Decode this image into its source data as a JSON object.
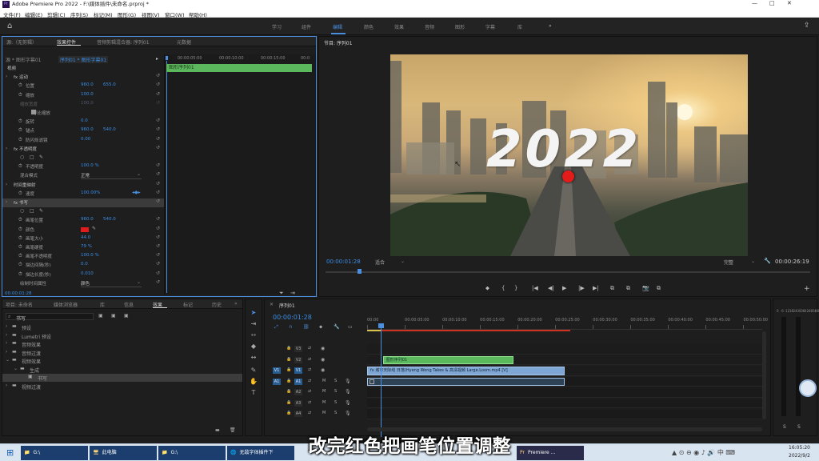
{
  "window": {
    "title": "Adobe Premiere Pro 2022 - F:\\媒体插件\\未命名.prproj *",
    "controls": [
      "—",
      "□",
      "✕"
    ]
  },
  "menu": [
    "文件(F)",
    "编辑(E)",
    "剪辑(C)",
    "序列(S)",
    "标记(M)",
    "图形(G)",
    "视图(V)",
    "窗口(W)",
    "帮助(H)"
  ],
  "workspaces": [
    "学习",
    "组件",
    "编辑",
    "颜色",
    "效果",
    "音频",
    "图形",
    "字幕",
    "库",
    "»"
  ],
  "active_workspace": "编辑",
  "effect_controls": {
    "tabs": [
      "源:（无剪辑）",
      "效果控件",
      "音频剪辑混合器: 序列01",
      "元数据"
    ],
    "source_label": "源 * 图形字幕01",
    "sequence_label": "序列01 * 图形字幕01",
    "ruler": [
      "00:00:05:00",
      "00:00:10:00",
      "00:00:15:00",
      "00:0"
    ],
    "clip_name": "图形序列01",
    "timecode": "00:00:01:28",
    "rows": [
      {
        "label": "视频",
        "indent": 0
      },
      {
        "label": "fx  运动",
        "indent": 1
      },
      {
        "label": "位置",
        "indent": 2,
        "v1": "960.0",
        "v2": "655.0",
        "sw": true
      },
      {
        "label": "缩放",
        "indent": 2,
        "v1": "100.0",
        "sw": true
      },
      {
        "label": "缩放宽度",
        "indent": 2,
        "v1": "100.0",
        "dim": true
      },
      {
        "label": "等比缩放",
        "indent": 4,
        "check": true
      },
      {
        "label": "旋转",
        "indent": 2,
        "v1": "0.0",
        "sw": true
      },
      {
        "label": "锚点",
        "indent": 2,
        "v1": "960.0",
        "v2": "540.0",
        "sw": true
      },
      {
        "label": "防闪烁滤镜",
        "indent": 2,
        "v1": "0.00",
        "sw": true
      },
      {
        "label": "fx  不透明度",
        "indent": 1
      },
      {
        "label": "shapes",
        "indent": 2
      },
      {
        "label": "不透明度",
        "indent": 2,
        "v1": "100.0 %",
        "sw": true
      },
      {
        "label": "混合模式",
        "indent": 2,
        "v1": "正常",
        "select": true
      },
      {
        "label": "时间重映射",
        "indent": 1
      },
      {
        "label": "速度",
        "indent": 2,
        "v1": "100.00%",
        "sw": true
      },
      {
        "label": "fx  书写",
        "indent": 1,
        "highlight": true
      },
      {
        "label": "shapes",
        "indent": 2
      },
      {
        "label": "画笔位置",
        "indent": 2,
        "v1": "960.0",
        "v2": "540.0",
        "sw": true
      },
      {
        "label": "颜色",
        "indent": 2,
        "color": "#e31b1b",
        "sw": true
      },
      {
        "label": "画笔大小",
        "indent": 2,
        "v1": "44.0",
        "sw": true
      },
      {
        "label": "画笔硬度",
        "indent": 2,
        "v1": "79 %",
        "sw": true
      },
      {
        "label": "画笔不透明度",
        "indent": 2,
        "v1": "100.0 %",
        "sw": true
      },
      {
        "label": "描边间隔(秒)",
        "indent": 2,
        "v1": "0.0",
        "sw": true
      },
      {
        "label": "描边长度(秒)",
        "indent": 2,
        "v1": "0.010",
        "sw": true
      },
      {
        "label": "绘制时间属性",
        "indent": 2,
        "v1": "颜色",
        "select": true
      }
    ]
  },
  "program": {
    "tab": "节目: 序列01",
    "timecode": "00:00:01:28",
    "fit": "适合",
    "quality": "完整",
    "duration": "00:00:26:19",
    "overlay_text": "2022",
    "brush_color": "#e31b1b"
  },
  "transport": [
    "⬥",
    "{",
    "}",
    "|◀",
    "◀|",
    "▶",
    "|▶",
    "▶|",
    "⧉",
    "⧉",
    "📷",
    "⧉"
  ],
  "project": {
    "tabs": [
      "项目: 未命名",
      "媒体浏览器",
      "库",
      "信息",
      "效果",
      "标记",
      "历史",
      "»"
    ],
    "search": "书写",
    "tree": [
      {
        "label": "预设",
        "level": 0
      },
      {
        "label": "Lumetri 预设",
        "level": 0
      },
      {
        "label": "音频效果",
        "level": 0
      },
      {
        "label": "音频过渡",
        "level": 0
      },
      {
        "label": "视频效果",
        "level": 0,
        "open": true
      },
      {
        "label": "生成",
        "level": 1,
        "open": true
      },
      {
        "label": "书写",
        "level": 2,
        "selected": true
      },
      {
        "label": "视频过渡",
        "level": 0
      }
    ]
  },
  "timeline": {
    "tab": "序列01",
    "timecode": "00:00:01:28",
    "ruler": [
      "00:00",
      "00:00:05:00",
      "00:00:10:00",
      "00:00:15:00",
      "00:00:20:00",
      "00:00:25:00",
      "00:00:30:00",
      "00:00:35:00",
      "00:00:40:00",
      "00:00:45:00",
      "00:00:50:00"
    ],
    "tracks": [
      {
        "name": "V3",
        "type": "video"
      },
      {
        "name": "V2",
        "type": "video"
      },
      {
        "name": "V1",
        "type": "video",
        "src": "V1"
      },
      {
        "name": "A1",
        "type": "audio",
        "src": "A1"
      },
      {
        "name": "A2",
        "type": "audio"
      },
      {
        "name": "A3",
        "type": "audio"
      },
      {
        "name": "A4",
        "type": "audio"
      }
    ],
    "clips": [
      {
        "label": "图形序列01",
        "track": "V2",
        "start": 0.04,
        "end": 0.37
      },
      {
        "label": "fx 城市天际线 日落(Hyeng Wong Takes & 高清视频 Large.Loom.mp4 [V]",
        "track": "V1",
        "start": 0.0,
        "end": 0.5
      },
      {
        "label": "",
        "track": "A1",
        "start": 0.0,
        "end": 0.5
      }
    ],
    "playhead": 0.035,
    "work_area_end": 0.5,
    "meter": [
      "0",
      "-6",
      "-12",
      "-18",
      "-24",
      "-30",
      "-36",
      "-42",
      "-48",
      "-54",
      "dB"
    ],
    "meter_bottom": [
      "S",
      "S"
    ]
  },
  "subtitle": "改完红色把画笔位置调整",
  "taskbar": {
    "items": [
      "G:\\",
      "此电脑",
      "G:\\",
      "无敌字体插件下",
      "Premiere ..."
    ],
    "time": "16:05:20",
    "date": "2022/9/2"
  },
  "colors": {
    "accent": "#4a8fe0",
    "clip_green": "#5cb85c",
    "clip_blue": "#7fa7d6",
    "track_blue": "#2a5d8f"
  }
}
